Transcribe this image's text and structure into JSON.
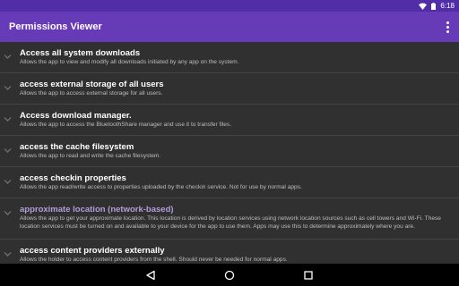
{
  "status_bar": {
    "time": "6:18"
  },
  "toolbar": {
    "title": "Permissions Viewer"
  },
  "permissions": [
    {
      "title": "Access all system downloads",
      "description": "Allows the app to view and modify all downloads initiated by any app on the system."
    },
    {
      "title": "access external storage of all users",
      "description": "Allows the app to access external storage for all users."
    },
    {
      "title": "Access download manager.",
      "description": "Allows the app to access the BluetoothShare manager and use it to transfer files."
    },
    {
      "title": "access the cache filesystem",
      "description": "Allows the app to read and write the cache filesystem."
    },
    {
      "title": "access checkin properties",
      "description": "Allows the app read/write access to properties uploaded by the checkin service. Not for use by normal apps."
    },
    {
      "title": "approximate location (network-based)",
      "description": "Allows the app to get your approximate location. This location is derived by location services using network location sources such as cell towers and Wi-Fi. These location services must be turned on and available to your device for the app to use them. Apps may use this to determine approximately where you are."
    },
    {
      "title": "access content providers externally",
      "description": "Allows the holder to access content providers from the shell. Should never be needed for normal apps."
    }
  ],
  "colors": {
    "status_bar": "#512DA8",
    "toolbar": "#673AB7",
    "background": "#303030",
    "accent_title": "#B39DDB"
  },
  "icons": {
    "status": [
      "wifi-icon",
      "battery-icon"
    ],
    "toolbar": [
      "overflow-menu-icon"
    ],
    "rows": "chevron-down-icon",
    "navigation": [
      "back-icon",
      "home-icon",
      "recents-icon"
    ]
  }
}
